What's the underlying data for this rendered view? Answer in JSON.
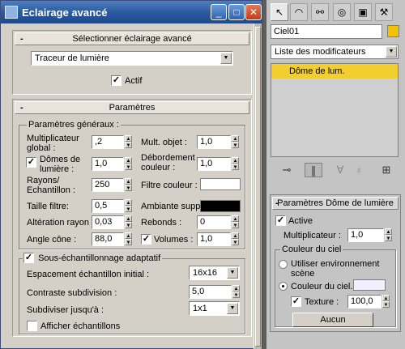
{
  "window": {
    "title": "Eclairage avancé",
    "controls": [
      "_",
      "□",
      "✕"
    ]
  },
  "select_rollout": {
    "header": "Sélectionner éclairage avancé",
    "dropdown_value": "Traceur de lumière",
    "actif_label": "Actif",
    "actif_checked": "✓"
  },
  "params_rollout": {
    "header": "Paramètres",
    "general_group": "Paramètres généraux :",
    "multiplicateur_global": {
      "label": "Multiplicateur global :",
      "value": ",2"
    },
    "mult_objet": {
      "label": "Mult. objet :",
      "value": "1,0"
    },
    "domes_de_lumiere": {
      "label": "Dômes de lumière :",
      "value": "1,0",
      "checked": "✓"
    },
    "debordement_couleur": {
      "label": "Débordement couleur :",
      "value": "1,0"
    },
    "rayons_echantillon": {
      "label": "Rayons/ Echantillon :",
      "value": "250"
    },
    "filtre_couleur": {
      "label": "Filtre couleur :",
      "color": "#ffffff"
    },
    "taille_filtre": {
      "label": "Taille filtre:",
      "value": "0,5"
    },
    "ambiante_suppl": {
      "label": "Ambiante suppl.:",
      "color": "#000000"
    },
    "alteration_rayon": {
      "label": "Altération rayon :",
      "value": "0,03"
    },
    "rebonds": {
      "label": "Rebonds :",
      "value": "0"
    },
    "angle_cone": {
      "label": "Angle cône :",
      "value": "88,0"
    },
    "volumes": {
      "label": "Volumes :",
      "value": "1,0",
      "checked": "✓"
    },
    "sous_echantillonnage": {
      "label": "Sous-échantillonnage adaptatif",
      "checked": "✓"
    },
    "espacement": {
      "label": "Espacement échantillon initial :",
      "value": "16x16"
    },
    "contraste": {
      "label": "Contraste subdivision :",
      "value": "5,0"
    },
    "subdiviser": {
      "label": "Subdiviser jusqu'à :",
      "value": "1x1"
    },
    "afficher": {
      "label": "Afficher échantillons",
      "checked": ""
    }
  },
  "command_panel": {
    "tabs": [
      {
        "icon": "create-icon",
        "glyph": "↖"
      },
      {
        "icon": "modify-icon",
        "glyph": "◠"
      },
      {
        "icon": "hierarchy-icon",
        "glyph": "⚯"
      },
      {
        "icon": "motion-icon",
        "glyph": "◎"
      },
      {
        "icon": "display-icon",
        "glyph": "▣"
      },
      {
        "icon": "utilities-icon",
        "glyph": "⚒"
      }
    ],
    "object_name": "Ciel01",
    "object_color": "#f2c200",
    "modifier_list": "Liste des modificateurs",
    "stack_item": "Dôme de lum.",
    "stack_tools": [
      "pin-stack-icon",
      "show-end-result-icon",
      "make-unique-icon",
      "remove-modifier-icon",
      "configure-sets-icon"
    ],
    "dome_rollout": {
      "header": "Paramètres Dôme de lumière",
      "active": {
        "label": "Active",
        "checked": "✓"
      },
      "multiplicateur": {
        "label": "Multiplicateur :",
        "value": "1,0"
      },
      "sky_group": "Couleur du ciel",
      "use_env": "Utiliser environnement scène",
      "sky_color_label": "Couleur du ciel...",
      "sky_color": "#f0f0ff",
      "texture": {
        "label": "Texture :",
        "value": "100,0",
        "checked": "✓"
      },
      "texture_button": "Aucun"
    }
  }
}
